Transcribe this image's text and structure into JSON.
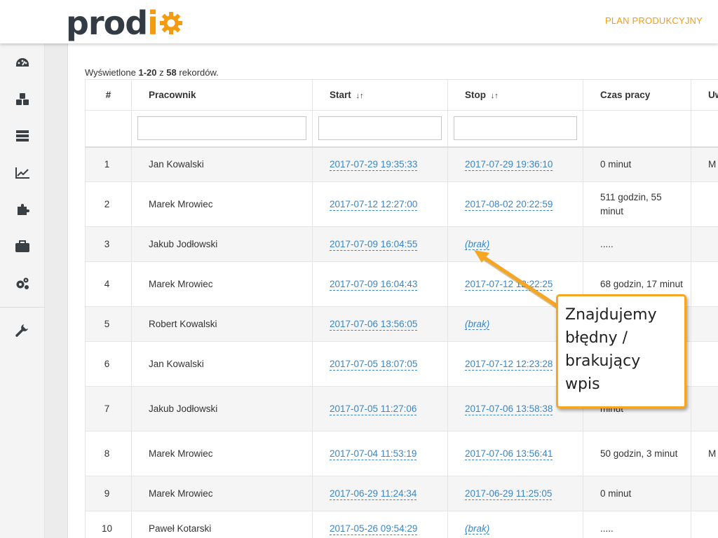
{
  "header": {
    "logo_main": "prod",
    "logo_accent": "i",
    "plan_link": "PLAN PRODUKCYJNY"
  },
  "sidebar": {
    "items": [
      {
        "icon": "dashboard-icon"
      },
      {
        "icon": "cubes-icon"
      },
      {
        "icon": "list-icon"
      },
      {
        "icon": "chart-icon"
      },
      {
        "icon": "puzzle-icon"
      },
      {
        "icon": "briefcase-icon"
      },
      {
        "icon": "gears-icon"
      },
      {
        "icon": "wrench-icon"
      }
    ]
  },
  "summary": {
    "prefix": "Wyświetlone",
    "range": "1-20",
    "of": "z",
    "total": "58",
    "suffix": "rekordów."
  },
  "table": {
    "columns": {
      "num": "#",
      "worker": "Pracownik",
      "start": "Start",
      "stop": "Stop",
      "duration": "Czas pracy",
      "extra": "Uw"
    },
    "sort_icon": "↓↑",
    "rows": [
      {
        "num": "1",
        "worker": "Jan Kowalski",
        "start": "2017-07-29 19:35:33",
        "stop": "2017-07-29 19:36:10",
        "duration": "0 minut",
        "extra": "M"
      },
      {
        "num": "2",
        "worker": "Marek Mrowiec",
        "start": "2017-07-12 12:27:00",
        "stop": "2017-08-02 20:22:59",
        "duration": "511 godzin, 55 minut",
        "extra": ""
      },
      {
        "num": "3",
        "worker": "Jakub Jodłowski",
        "start": "2017-07-09 16:04:55",
        "stop": "(brak)",
        "duration": ".....",
        "extra": ""
      },
      {
        "num": "4",
        "worker": "Marek Mrowiec",
        "start": "2017-07-09 16:04:43",
        "stop": "2017-07-12 12:22:25",
        "duration": "68 godzin, 17 minut",
        "extra": ""
      },
      {
        "num": "5",
        "worker": "Robert Kowalski",
        "start": "2017-07-06 13:56:05",
        "stop": "(brak)",
        "duration": "",
        "extra": ""
      },
      {
        "num": "6",
        "worker": "Jan Kowalski",
        "start": "2017-07-05 18:07:05",
        "stop": "2017-07-12 12:23:28",
        "duration": "",
        "extra": ""
      },
      {
        "num": "7",
        "worker": "Jakub Jodłowski",
        "start": "2017-07-05 11:27:06",
        "stop": "2017-07-06 13:58:38",
        "duration": "minut",
        "extra": ""
      },
      {
        "num": "8",
        "worker": "Marek Mrowiec",
        "start": "2017-07-04 11:53:19",
        "stop": "2017-07-06 13:56:41",
        "duration": "50 godzin, 3 minut",
        "extra": "M"
      },
      {
        "num": "9",
        "worker": "Marek Mrowiec",
        "start": "2017-06-29 11:24:34",
        "stop": "2017-06-29 11:25:05",
        "duration": "0 minut",
        "extra": ""
      },
      {
        "num": "10",
        "worker": "Paweł Kotarski",
        "start": "2017-05-26 09:54:29",
        "stop": "(brak)",
        "duration": ".....",
        "extra": ""
      }
    ]
  },
  "annotation": {
    "text": "Znajdujemy\nbłędny /\nbrakujący\nwpis"
  },
  "colors": {
    "accent": "#f39c12",
    "link": "#3a86c8",
    "callout_border": "#f5a623"
  }
}
